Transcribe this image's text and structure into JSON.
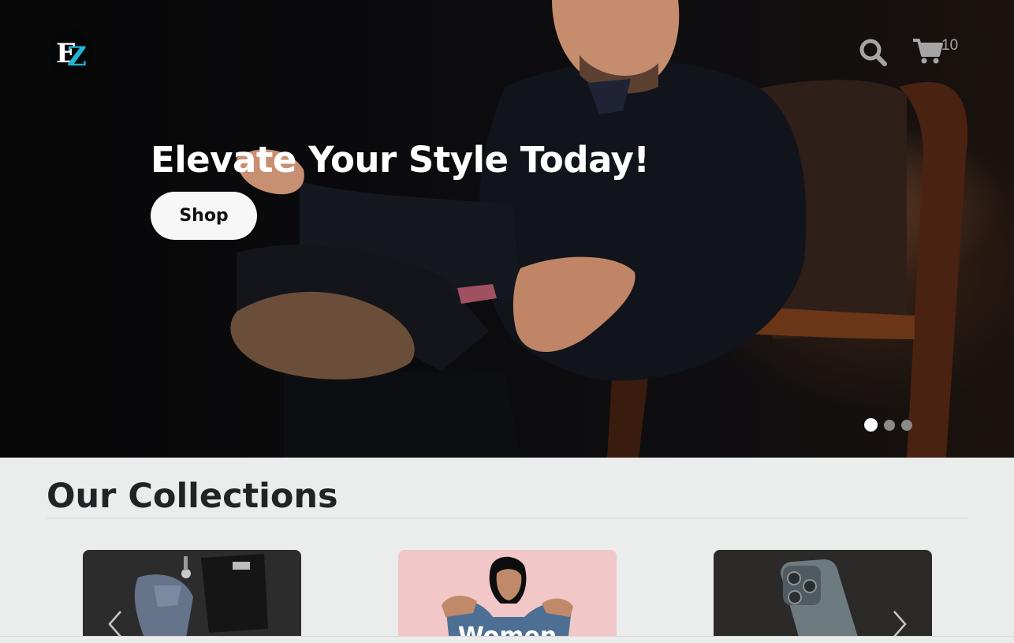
{
  "header": {
    "logo_text": "EZ",
    "cart_count": "10",
    "icons": {
      "search": "search-icon",
      "cart": "cart-icon"
    }
  },
  "hero": {
    "title": "Elevate Your Style Today!",
    "cta_label": "Shop",
    "slides_total": 3,
    "active_slide": 1
  },
  "collections": {
    "title": "Our Collections",
    "cards": [
      {
        "label": ""
      },
      {
        "label": "Women"
      },
      {
        "label": ""
      }
    ],
    "icons": {
      "prev": "chevron-left-icon",
      "next": "chevron-right-icon"
    }
  },
  "colors": {
    "accent": "#1fb6d6",
    "hero_text": "#ffffff",
    "button_bg": "#f7f7f7",
    "page_bg": "#ebecec",
    "heading": "#212325"
  }
}
